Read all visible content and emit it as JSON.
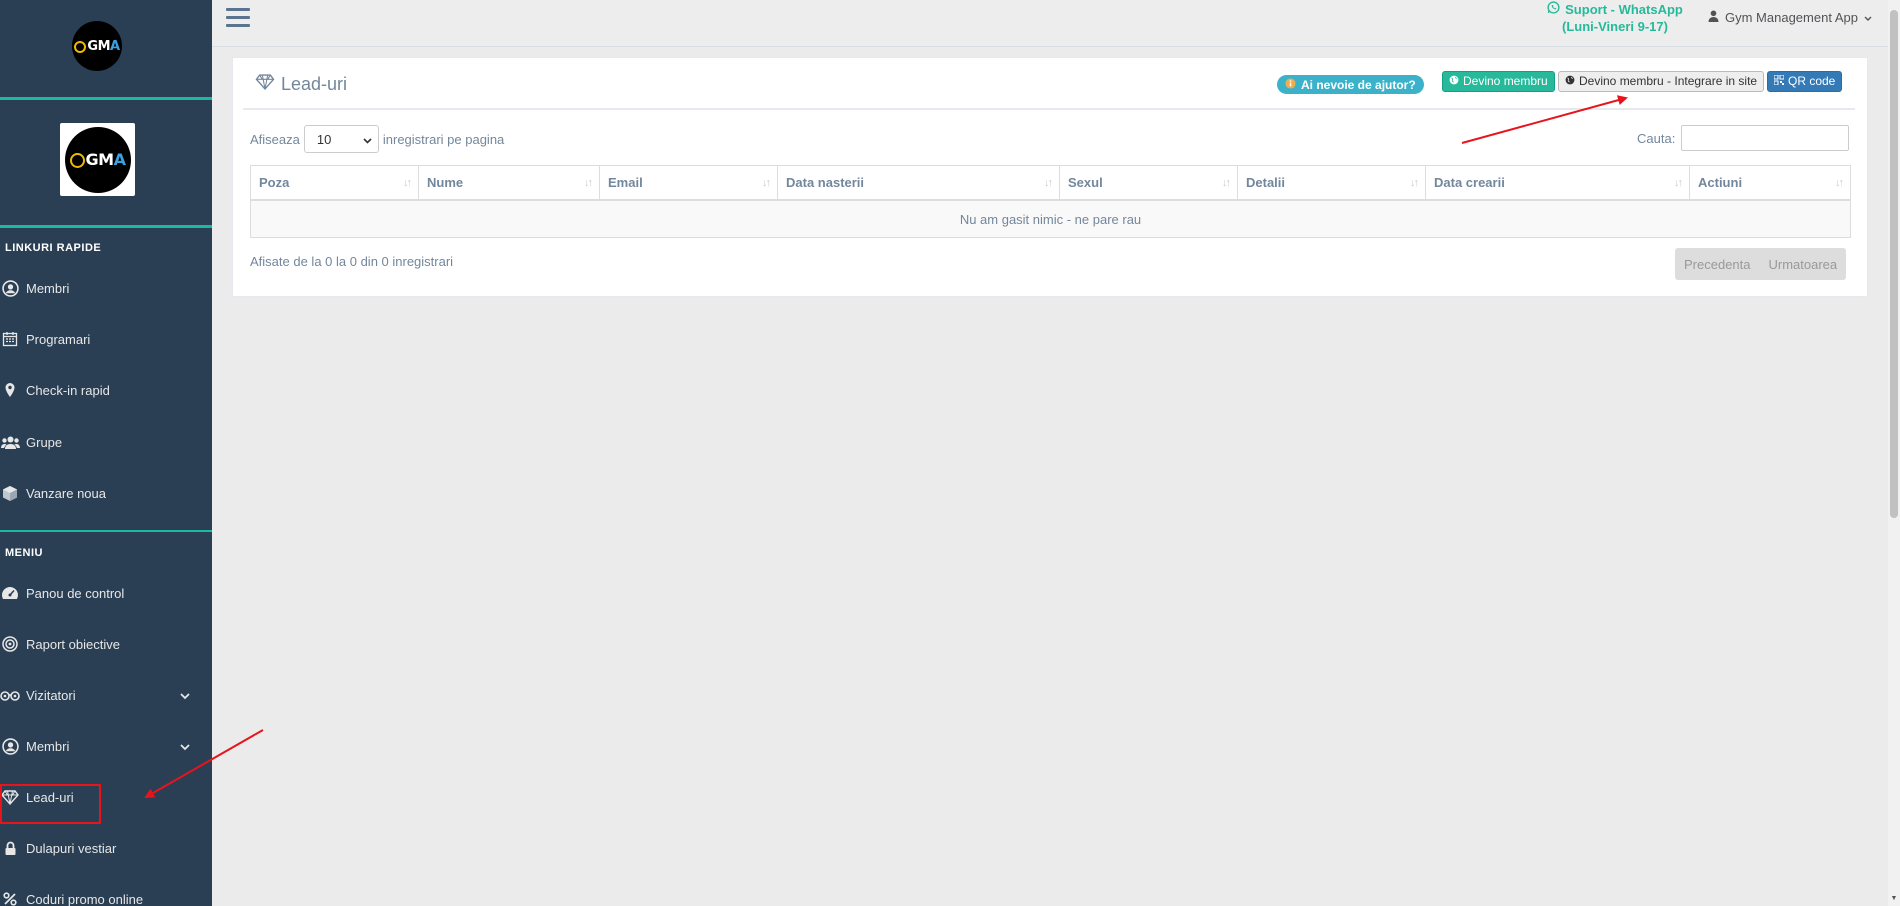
{
  "sidebar": {
    "logo_text": {
      "pre": "GM",
      "accent": "A"
    },
    "quick_links_title": "LINKURI RAPIDE",
    "quick_links": [
      {
        "label": "Membri",
        "icon": "user-circle-icon"
      },
      {
        "label": "Programari",
        "icon": "calendar-icon"
      },
      {
        "label": "Check-in rapid",
        "icon": "map-marker-icon"
      },
      {
        "label": "Grupe",
        "icon": "users-icon"
      },
      {
        "label": "Vanzare noua",
        "icon": "cube-icon"
      }
    ],
    "menu_title": "MENIU",
    "menu": [
      {
        "label": "Panou de control",
        "icon": "dashboard-icon"
      },
      {
        "label": "Raport obiective",
        "icon": "bullseye-icon"
      },
      {
        "label": "Vizitatori",
        "icon": "binoculars-icon"
      },
      {
        "label": "Membri",
        "icon": "user-circle-icon"
      },
      {
        "label": "Lead-uri",
        "icon": "diamond-icon"
      },
      {
        "label": "Dulapuri vestiar",
        "icon": "lock-icon"
      },
      {
        "label": "Coduri promo online",
        "icon": "percent-icon"
      }
    ]
  },
  "topnav": {
    "support_line1": "Suport - WhatsApp",
    "support_line2": "(Luni-Vineri 9-17)",
    "user_name": "Gym Management App"
  },
  "page": {
    "title": "Lead-uri",
    "help_badge": "Ai nevoie de ajutor?",
    "buttons": {
      "become_member": "Devino membru",
      "become_member_integration": "Devino membru - Integrare in site",
      "qr_code": "QR code"
    },
    "length": {
      "prefix": "Afiseaza",
      "value": "10",
      "suffix": "inregistrari pe pagina"
    },
    "search_label": "Cauta:",
    "table": {
      "columns": [
        "Poza",
        "Nume",
        "Email",
        "Data nasterii",
        "Sexul",
        "Detalii",
        "Data crearii",
        "Actiuni"
      ],
      "empty_message": "Nu am gasit nimic - ne pare rau"
    },
    "info": "Afisate de la 0 la 0 din 0 inregistrari",
    "pagination": {
      "prev": "Precedenta",
      "next": "Urmatoarea"
    }
  },
  "colors": {
    "sidebar_bg": "#2a3f54",
    "accent_teal": "#1abb9c",
    "annotation_red": "#e8141c",
    "primary_blue": "#337ab7",
    "success_green": "#26b99a",
    "info_cyan": "#3bb2c9"
  }
}
